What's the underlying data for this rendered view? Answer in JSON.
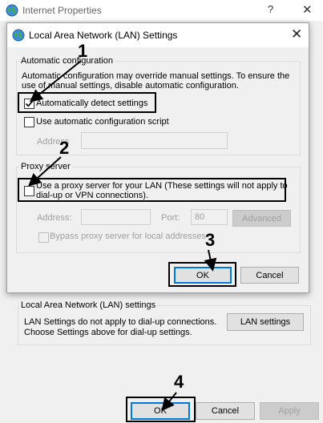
{
  "internet_properties": {
    "title": "Internet Properties",
    "help_glyph": "?",
    "close_glyph": "✕",
    "lan_group": {
      "title": "Local Area Network (LAN) settings",
      "desc_line1": "LAN Settings do not apply to dial-up connections.",
      "desc_line2": "Choose Settings above for dial-up settings.",
      "button": "LAN settings"
    },
    "buttons": {
      "ok": "OK",
      "cancel": "Cancel",
      "apply": "Apply"
    }
  },
  "lan_dialog": {
    "title": "Local Area Network (LAN) Settings",
    "close_glyph": "✕",
    "auto_config": {
      "group_title": "Automatic configuration",
      "desc_line1": "Automatic configuration may override manual settings.  To ensure the",
      "desc_line2": "use of manual settings, disable automatic configuration.",
      "detect_label": "Automatically detect settings",
      "detect_checked": true,
      "script_label": "Use automatic configuration script",
      "script_checked": false,
      "address_label": "Address"
    },
    "proxy": {
      "group_title": "Proxy server",
      "use_proxy_line1": "Use a proxy server for your LAN (These settings will not apply to",
      "use_proxy_line2": "dial-up or VPN connections).",
      "use_proxy_checked": false,
      "address_label": "Address:",
      "port_label": "Port:",
      "port_value": "80",
      "advanced_button": "Advanced",
      "bypass_label": "Bypass proxy server for local addresses",
      "bypass_checked": false
    },
    "buttons": {
      "ok": "OK",
      "cancel": "Cancel"
    }
  },
  "annotations": [
    "1",
    "2",
    "3",
    "4"
  ],
  "colors": {
    "focus_border": "#0078d7",
    "dialog_bg": "#f0f0f0",
    "disabled_text": "#a0a0a0"
  }
}
